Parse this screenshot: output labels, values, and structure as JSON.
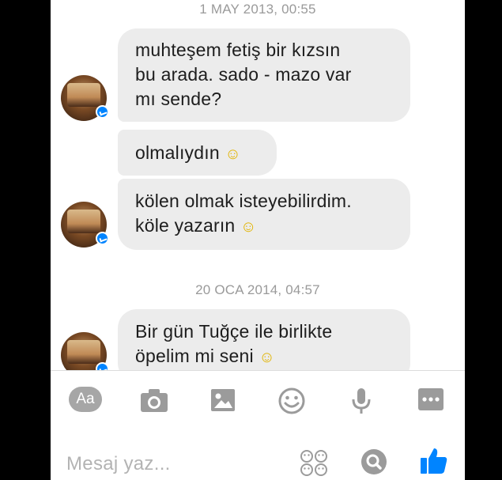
{
  "timestamps": [
    "1 MAY 2013, 00:55",
    "20 OCA 2014, 04:57"
  ],
  "messages": [
    {
      "lines": [
        "muhteşem fetiş bir kızsın",
        "bu arada. sado - mazo var",
        "mı sende?"
      ]
    },
    {
      "text": "olmalıydın",
      "emoji": "☺"
    },
    {
      "lines": [
        "kölen olmak isteyebilirdim.",
        "köle yazarın"
      ],
      "emoji": "☺"
    },
    {
      "lines": [
        "Bir gün Tuğçe ile birlikte",
        "öpelim mi seni"
      ],
      "emoji": "☺"
    }
  ],
  "toolbar": {
    "text_format_label": "Aa",
    "icons": [
      "text-format-icon",
      "camera-icon",
      "gallery-icon",
      "emoji-icon",
      "microphone-icon",
      "more-icon"
    ]
  },
  "composer": {
    "placeholder": "Mesaj yaz...",
    "icons": [
      "stickers-icon",
      "gif-search-icon",
      "like-icon"
    ]
  },
  "colors": {
    "accent": "#0084ff",
    "bubble": "#ececec",
    "icon_gray": "#9b9b9b"
  }
}
